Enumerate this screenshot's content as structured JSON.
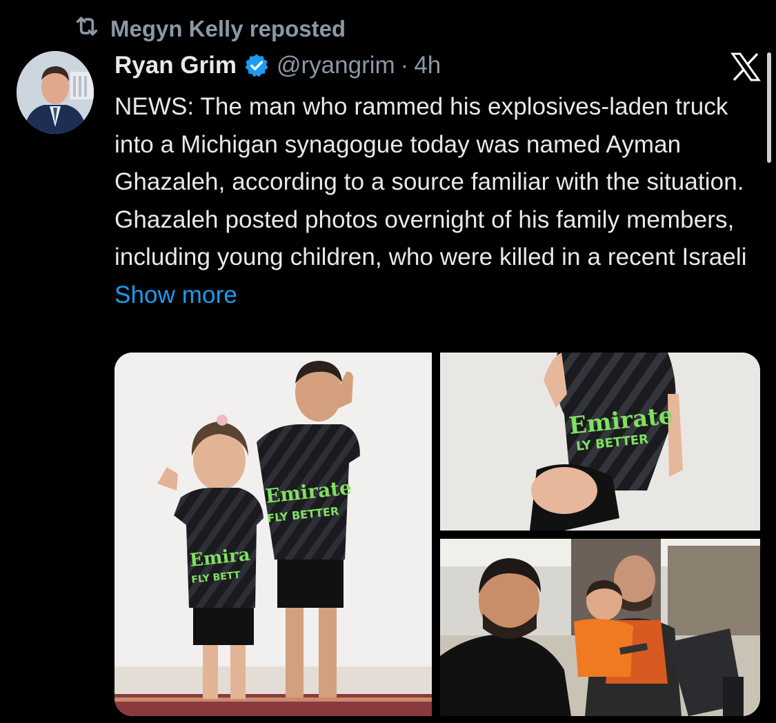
{
  "repost": {
    "icon": "repost-icon",
    "label": "Megyn Kelly reposted"
  },
  "tweet": {
    "author_name": "Ryan Grim",
    "verified_icon": "verified-badge-icon",
    "handle": "@ryangrim",
    "separator": "·",
    "time": "4h",
    "text": "NEWS: The man who rammed his explosives-laden truck into a Michigan synagogue today was named Ayman Ghazaleh, according to a source familiar with the situation. Ghazaleh posted photos overnight of his family members, including young children, who were killed in a recent Israeli",
    "show_more": "Show more",
    "platform_icon": "x-logo-icon"
  },
  "colors": {
    "background": "#000000",
    "text": "#e7e9ea",
    "secondary": "#8b98a5",
    "link": "#1d9bf0",
    "verified": "#1d9bf0"
  },
  "photos": {
    "jersey_text_1": "Emirate",
    "jersey_sub_1": "FLY BETTER",
    "jersey_text_2": "Emira",
    "jersey_sub_2": "FLY BETT",
    "jersey_text_3": "Emirate",
    "jersey_sub_3": "LY BETTER"
  }
}
